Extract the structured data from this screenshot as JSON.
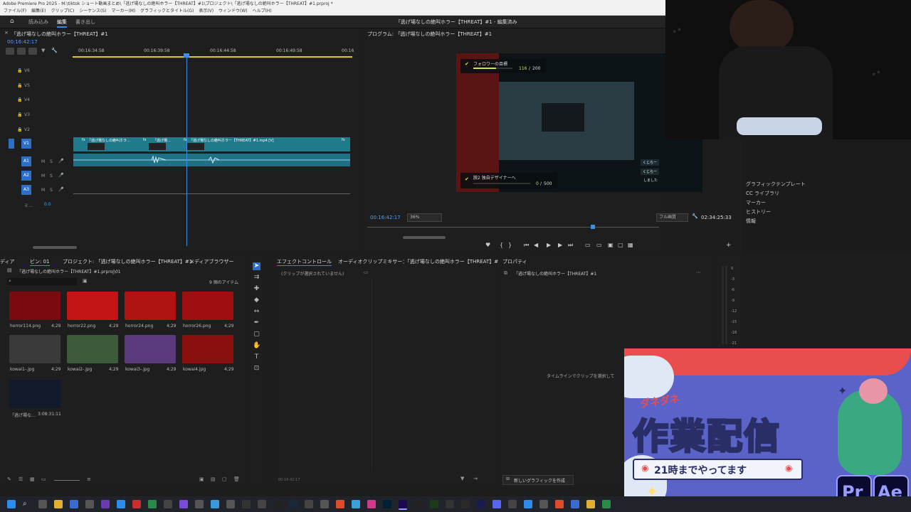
{
  "app": {
    "title": "Adobe Premiere Pro 2025 - M:\\tiktok ショート動画まとめ\\「逃げ場なしの絶叫ホラー【THREAT】#1\\プロジェクト\\「逃げ場なしの絶叫ホラー【THREAT】#1.prproj *",
    "menu": [
      "ファイル(F)",
      "編集(E)",
      "クリップ(C)",
      "シーケンス(S)",
      "マーカー(M)",
      "グラフィックとタイトル(G)",
      "表示(V)",
      "ウィンドウ(W)",
      "ヘルプ(H)"
    ],
    "workspace_tabs": [
      "読み込み",
      "編集",
      "書き出し"
    ],
    "center_title": "「逃げ場なしの絶叫ホラー【THREAT】#1 - 編集済み"
  },
  "timeline": {
    "title": "「逃げ場なしの絶叫ホラー【THREAT】#1",
    "timecode": "00:16:42:17",
    "ruler": [
      "00:16:34:58",
      "00:16:39:58",
      "00:16:44:58",
      "00:16:49:58",
      "00:16"
    ],
    "video_tracks": [
      "V6",
      "V5",
      "V4",
      "V3",
      "V2",
      "V1"
    ],
    "audio_tracks": [
      "A1",
      "A2",
      "A3"
    ],
    "track_buttons": [
      "M",
      "S"
    ],
    "mix_label": "ミ…",
    "mix_value": "0.0",
    "fx_badge": "fx",
    "clip_label_1": "「逃げ場なしの絶叫ホラ…",
    "clip_label_2": "「逃げ場…",
    "clip_label_3": "「逃げ場なしの絶叫ホラー【THREAT】#1.mp4 [V]"
  },
  "program": {
    "title": "プログラム: 「逃げ場なしの絶叫ホラー【THREAT】#1",
    "timecode": "00:16:42:17",
    "zoom": "36%",
    "quality": "フル画質",
    "duration": "02:34:25:33",
    "goal1_label": "フォロワーの目標",
    "goal1_value": "116",
    "goal1_max": "200",
    "goal1_progress": 0.58,
    "goal2_label": "脱2 独自デザイナーへ",
    "goal2_value": "0",
    "goal2_max": "500",
    "goal2_progress": 0,
    "chat": [
      "くじらー",
      "くじらー",
      "しました"
    ]
  },
  "project": {
    "tabs": [
      "ディア",
      "ビン: 01",
      "プロジェクト: 「逃げ場なしの絶叫ホラー【THREAT】#1",
      "メディアブラウザー"
    ],
    "path": "「逃げ場なしの絶叫ホラー【THREAT】#1.prproj\\01",
    "count": "9 個のアイテム",
    "items": [
      {
        "name": "horror114.png",
        "dur": "4;29",
        "color": "#7a0a10"
      },
      {
        "name": "horror22.png",
        "dur": "4;29",
        "color": "#c31515"
      },
      {
        "name": "horror24.png",
        "dur": "4;29",
        "color": "#b01212"
      },
      {
        "name": "horror26.png",
        "dur": "4;29",
        "color": "#a00f0f"
      },
      {
        "name": "kowai1-.jpg",
        "dur": "4;29",
        "color": "#3a3a3a"
      },
      {
        "name": "kowai2-.jpg",
        "dur": "4;29",
        "color": "#3d5a3a"
      },
      {
        "name": "kowai3-.jpg",
        "dur": "4;29",
        "color": "#5a3a7a"
      },
      {
        "name": "kowai4.jpg",
        "dur": "4;29",
        "color": "#8a1010"
      },
      {
        "name": "「逃げ場な…",
        "dur": "3:08:31:11",
        "color": "#111a2a"
      }
    ]
  },
  "effects": {
    "tabs": [
      "エフェクトコントロール",
      "オーディオクリップミキサー：「逃げ場なしの絶叫ホラー【THREAT】#1"
    ],
    "empty": "(クリップが選択されていません)",
    "footer_time": "00:16:42:17"
  },
  "properties": {
    "title": "プロパティ",
    "item": "「逃げ場なしの絶叫ホラー【THREAT】#1",
    "hint": "タイムラインでクリップを選択して",
    "new_graphic": "新しいグラフィックを作成"
  },
  "right_panels": [
    "グラフィックテンプレート",
    "CC ライブラリ",
    "マーカー",
    "ヒストリー",
    "情報"
  ],
  "meter_ticks": [
    "0",
    "-3",
    "-6",
    "-9",
    "-12",
    "-15",
    "-18",
    "-21"
  ],
  "overlay": {
    "small_title": "ダネダネ",
    "big_title": "作業配信",
    "subtitle": "21時までやってます",
    "badge1": "Pr",
    "badge2": "Ae"
  },
  "colors": {
    "accent_blue": "#2d8ceb",
    "clip_teal": "#1f7a8c",
    "overlay_bg": "#5b63c9"
  }
}
